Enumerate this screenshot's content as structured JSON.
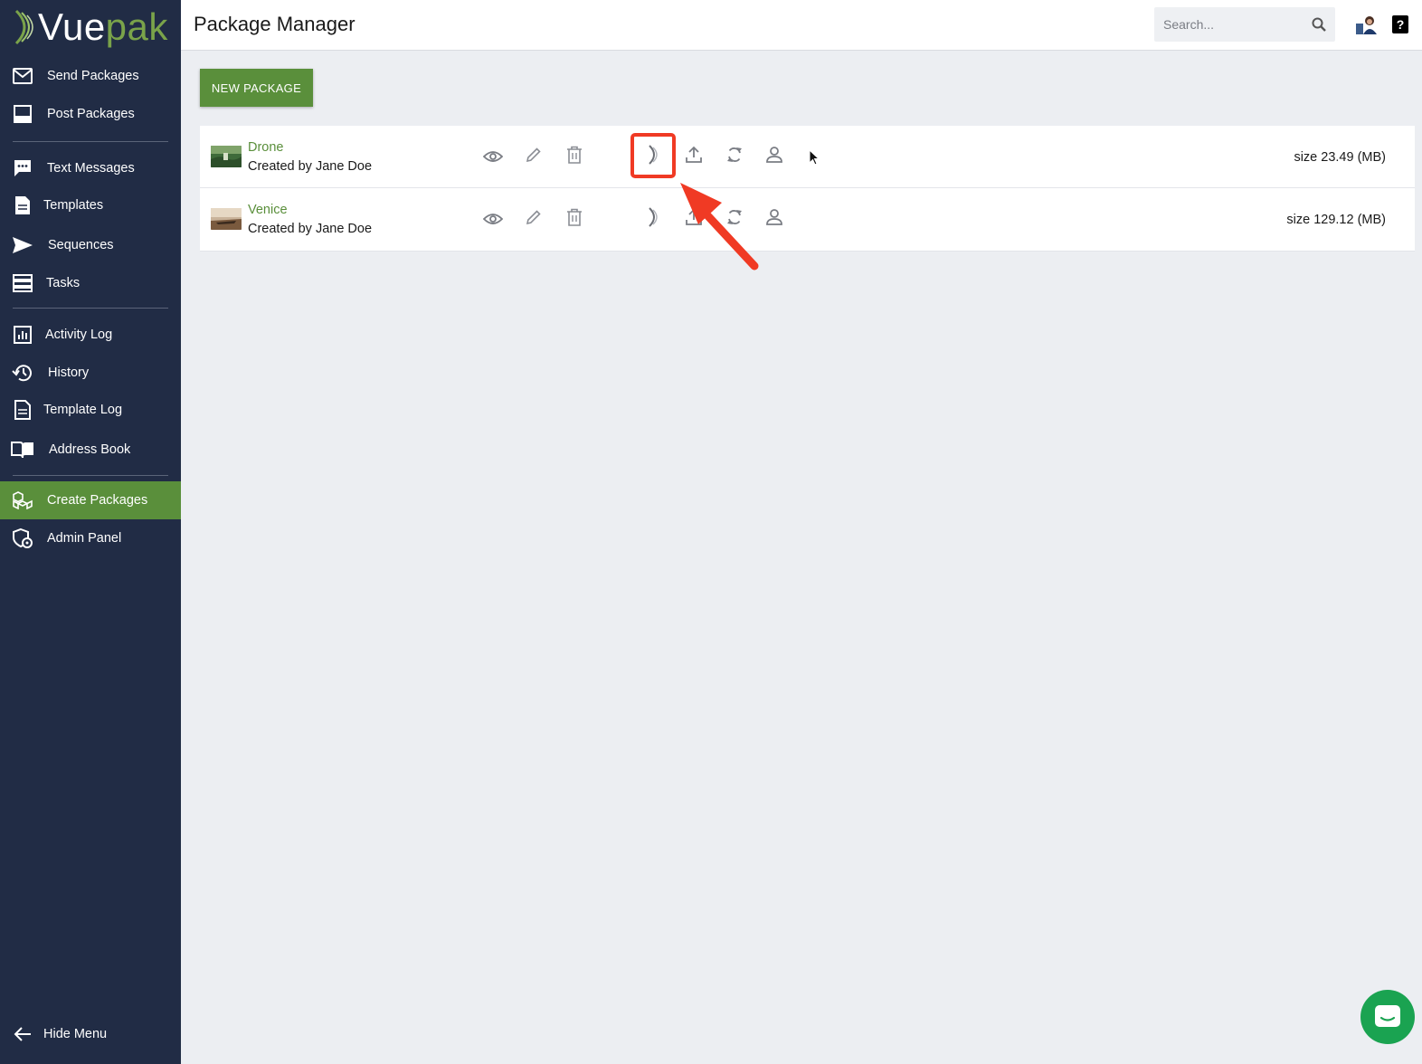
{
  "app": {
    "logo_vue": "Vue",
    "logo_pak": "pak",
    "title": "Package Manager"
  },
  "sidebar": {
    "items": [
      {
        "label": "Send Packages",
        "icon": "envelope-icon"
      },
      {
        "label": "Post Packages",
        "icon": "monitor-icon"
      },
      {
        "label": "Text Messages",
        "icon": "chat-bubble-icon"
      },
      {
        "label": "Templates",
        "icon": "document-icon"
      },
      {
        "label": "Sequences",
        "icon": "paper-plane-icon"
      },
      {
        "label": "Tasks",
        "icon": "list-icon"
      },
      {
        "label": "Activity Log",
        "icon": "bar-chart-icon"
      },
      {
        "label": "History",
        "icon": "history-icon"
      },
      {
        "label": "Template Log",
        "icon": "document-icon"
      },
      {
        "label": "Address Book",
        "icon": "book-icon"
      },
      {
        "label": "Create Packages",
        "icon": "boxes-icon",
        "active": true
      },
      {
        "label": "Admin Panel",
        "icon": "admin-shield-icon"
      }
    ],
    "hide_menu": "Hide Menu"
  },
  "header": {
    "search_placeholder": "Search...",
    "help": "?"
  },
  "main": {
    "new_package_label": "NEW PACKAGE",
    "packages": [
      {
        "name": "Drone",
        "creator": "Created by Jane Doe",
        "size": "size 23.49 (MB)"
      },
      {
        "name": "Venice",
        "creator": "Created by Jane Doe",
        "size": "size 129.12 (MB)"
      }
    ]
  },
  "colors": {
    "sidebar_bg": "#212c45",
    "accent_green": "#5a8f3b",
    "annotation_red": "#f03a24",
    "chat_green": "#1aa351"
  }
}
